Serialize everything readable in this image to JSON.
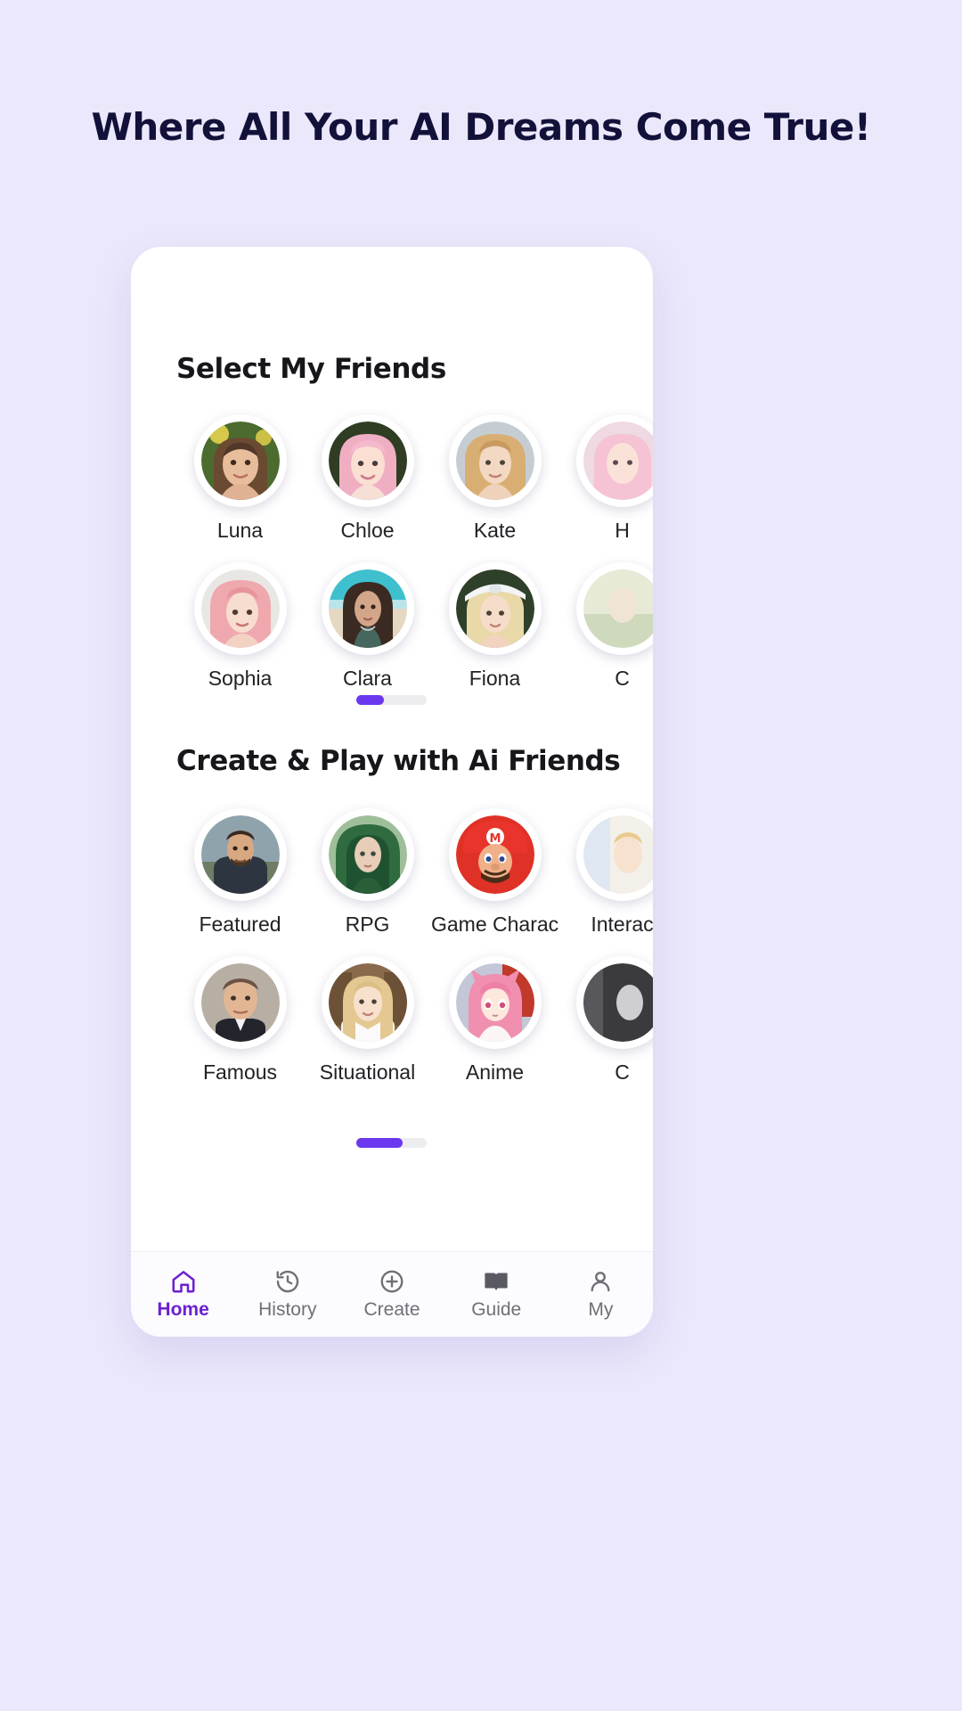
{
  "page": {
    "headline": "Where All Your AI Dreams Come True!",
    "background_color": "#EBE8FB",
    "headline_color": "#12113A",
    "accent_color": "#6B38EF"
  },
  "sections": [
    {
      "title": "Select My Friends",
      "scroll": {
        "position_percent": 0,
        "thumb_fraction": 0.39
      },
      "items": [
        {
          "label": "Luna",
          "icon": "avatar-luna"
        },
        {
          "label": "Chloe",
          "icon": "avatar-chloe"
        },
        {
          "label": "Kate",
          "icon": "avatar-kate"
        },
        {
          "label": "H",
          "icon": "avatar-partial-1"
        },
        {
          "label": "Sophia",
          "icon": "avatar-sophia"
        },
        {
          "label": "Clara",
          "icon": "avatar-clara"
        },
        {
          "label": "Fiona",
          "icon": "avatar-fiona"
        },
        {
          "label": "C",
          "icon": "avatar-partial-2"
        }
      ]
    },
    {
      "title": "Create & Play with Ai Friends",
      "scroll": {
        "position_percent": 0,
        "thumb_fraction": 0.66
      },
      "items": [
        {
          "label": "Featured",
          "icon": "avatar-featured"
        },
        {
          "label": "RPG",
          "icon": "avatar-rpg"
        },
        {
          "label": "Game Charact...",
          "icon": "avatar-game-character"
        },
        {
          "label": "Interac",
          "icon": "avatar-interactive"
        },
        {
          "label": "Famous",
          "icon": "avatar-famous"
        },
        {
          "label": "Situational",
          "icon": "avatar-situational"
        },
        {
          "label": "Anime",
          "icon": "avatar-anime"
        },
        {
          "label": "C",
          "icon": "avatar-partial-3"
        }
      ]
    }
  ],
  "navbar": {
    "items": [
      {
        "label": "Home",
        "icon": "home-icon",
        "active": true
      },
      {
        "label": "History",
        "icon": "history-icon",
        "active": false
      },
      {
        "label": "Create",
        "icon": "plus-circle-icon",
        "active": false
      },
      {
        "label": "Guide",
        "icon": "book-icon",
        "active": false
      },
      {
        "label": "My",
        "icon": "person-icon",
        "active": false
      }
    ],
    "active_color": "#6B21CF",
    "inactive_color": "#6F6F77"
  }
}
